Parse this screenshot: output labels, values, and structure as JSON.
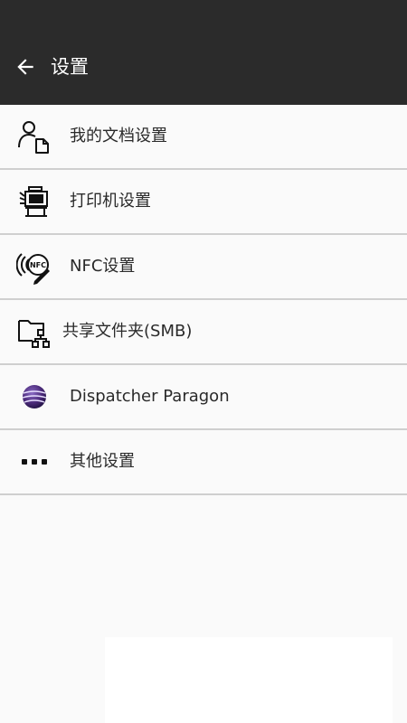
{
  "header": {
    "title": "设置",
    "back_icon": "arrow-left-icon",
    "background": "#2b2b2b"
  },
  "menu": {
    "items": [
      {
        "label": "我的文档设置",
        "icon": "user-document-icon"
      },
      {
        "label": "打印机设置",
        "icon": "printer-icon"
      },
      {
        "label": "NFC设置",
        "icon": "nfc-icon"
      },
      {
        "label": "共享文件夹(SMB)",
        "icon": "shared-folder-icon"
      },
      {
        "label": "Dispatcher Paragon",
        "icon": "dispatcher-paragon-logo-icon"
      },
      {
        "label": "其他设置",
        "icon": "more-dots-icon"
      }
    ]
  },
  "colors": {
    "divider": "#cfcfcf",
    "text": "#2a2a2a",
    "accent_logo": "#4b2a7a"
  }
}
